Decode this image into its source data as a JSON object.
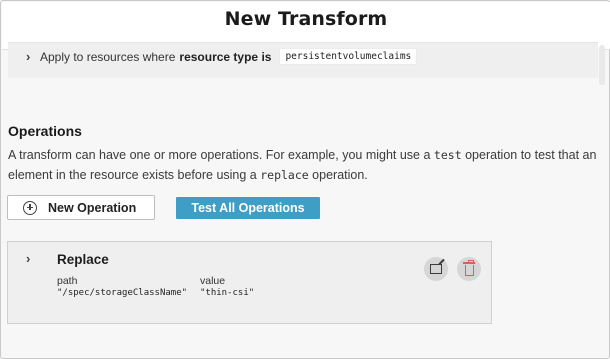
{
  "header": {
    "title": "New Transform"
  },
  "rule": {
    "prefix": "Apply to resources where",
    "bold": "resource type is",
    "value": "persistentvolumeclaims"
  },
  "operations": {
    "title": "Operations",
    "desc_part1": "A transform can have one or more operations. For example, you might use a ",
    "desc_code1": "test",
    "desc_part2": " operation to test that an element in the resource exists before using a ",
    "desc_code2": "replace",
    "desc_part3": " operation.",
    "new_button": "New Operation",
    "test_all_button": "Test All Operations"
  },
  "card": {
    "title": "Replace",
    "path_label": "path",
    "path_value": "\"/spec/storageClassName\"",
    "value_label": "value",
    "value_value": "\"thin-csi\"",
    "edit_icon": "edit-icon",
    "delete_icon": "trash-icon"
  }
}
